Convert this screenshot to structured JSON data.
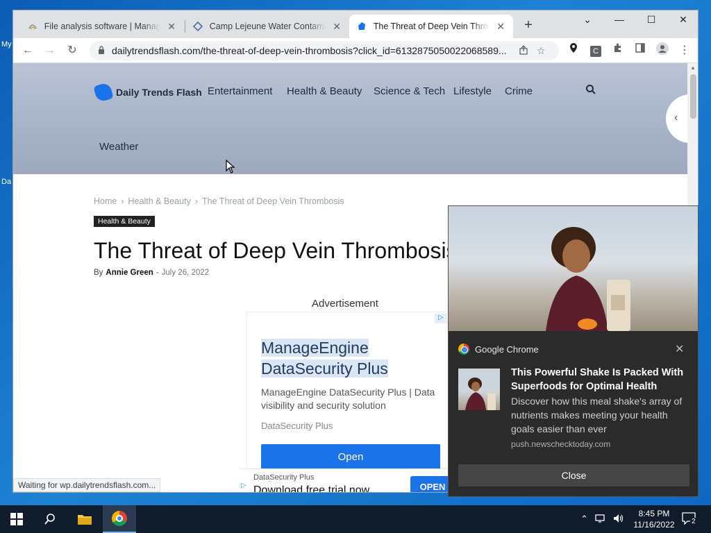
{
  "desktop": {
    "frag1": "My",
    "frag2": "Da"
  },
  "tabs": [
    {
      "title": "File analysis software | ManageE",
      "close": "✕"
    },
    {
      "title": "Camp Lejeune Water Contaminat",
      "close": "✕"
    },
    {
      "title": "The Threat of Deep Vein Thromb",
      "close": "✕"
    }
  ],
  "window": {
    "minimize": "—",
    "maximize": "☐",
    "close": "✕",
    "tab_menu": "⌄",
    "new_tab": "+"
  },
  "toolbar": {
    "back": "←",
    "forward": "→",
    "reload": "↻",
    "url": "dailytrendsflash.com/the-threat-of-deep-vein-thrombosis?click_id=6132875050022068589...",
    "ext_c": "C"
  },
  "site": {
    "logo_text": "Daily Trends Flash",
    "nav": [
      "Entertainment",
      "Health & Beauty",
      "Science & Tech",
      "Lifestyle",
      "Crime"
    ],
    "nav_weather": "Weather",
    "search_icon": "⌕",
    "side_chevron": "‹"
  },
  "article": {
    "breadcrumb": [
      "Home",
      "Health & Beauty",
      "The Threat of Deep Vein Thrombosis"
    ],
    "breadcrumb_sep": "›",
    "category": "Health & Beauty",
    "title": "The Threat of Deep Vein Thrombosis",
    "by": "By",
    "author": "Annie Green",
    "date_sep": "-",
    "date": "July 26, 2022",
    "ad_label": "Advertisement"
  },
  "ad": {
    "headline_line1": "ManageEngine",
    "headline_line2": "DataSecurity Plus",
    "description": "ManageEngine DataSecurity Plus | Data visibility and security solution",
    "brand": "DataSecurity Plus",
    "button": "Open"
  },
  "bottom_ad": {
    "brand": "DataSecurity Plus",
    "text": "Download free trial now",
    "button": "OPEN"
  },
  "status_bar": "Waiting for wp.dailytrendsflash.com...",
  "notification": {
    "app": "Google Chrome",
    "close_x": "✕",
    "title": "This Powerful Shake Is Packed With Superfoods for Optimal Health",
    "body": "Discover how this meal shake's array of nutrients makes meeting your health goals easier than ever",
    "source": "push.newschecktoday.com",
    "close_button": "Close"
  },
  "taskbar": {
    "time": "8:45 PM",
    "date": "11/16/2022",
    "notification_count": "2"
  }
}
